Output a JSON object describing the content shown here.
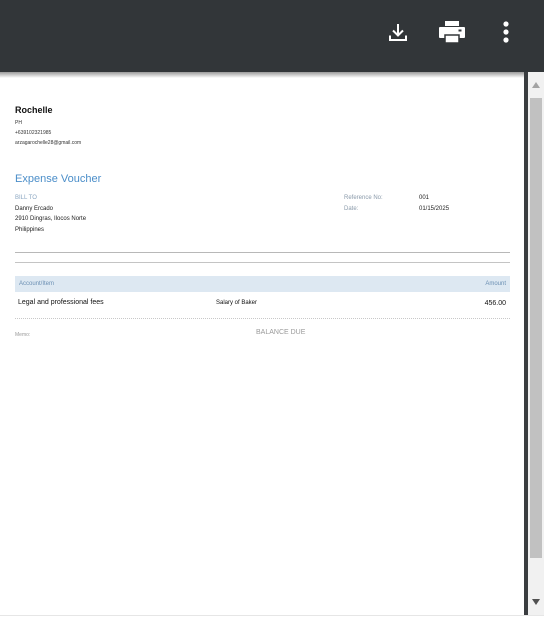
{
  "toolbar": {
    "download_icon": "download-icon",
    "print_icon": "print-icon",
    "more_icon": "more-vert-icon",
    "background": "#323639"
  },
  "document": {
    "company": {
      "name": "Rochelle",
      "country": "PH",
      "phone": "+639102321985",
      "email": "arzagarochelle28@gmail.com"
    },
    "title": "Expense Voucher",
    "bill_to": {
      "label": "BILL TO",
      "name": "Danny Ercado",
      "address": "2910 Dingras, Ilocos Norte",
      "country": "Philippines"
    },
    "meta": {
      "reference_label": "Reference No:",
      "reference_value": "001",
      "date_label": "Date:",
      "date_value": "01/15/2025"
    },
    "table": {
      "headers": {
        "account": "Account/Item",
        "amount": "Amount"
      },
      "rows": [
        {
          "account": "Legal and professional fees",
          "description": "Salary of Baker",
          "amount": "456.00"
        }
      ]
    },
    "memo_label": "Memo:",
    "balance_due_label": "BALANCE DUE",
    "accent_color": "#4b8ec9"
  }
}
